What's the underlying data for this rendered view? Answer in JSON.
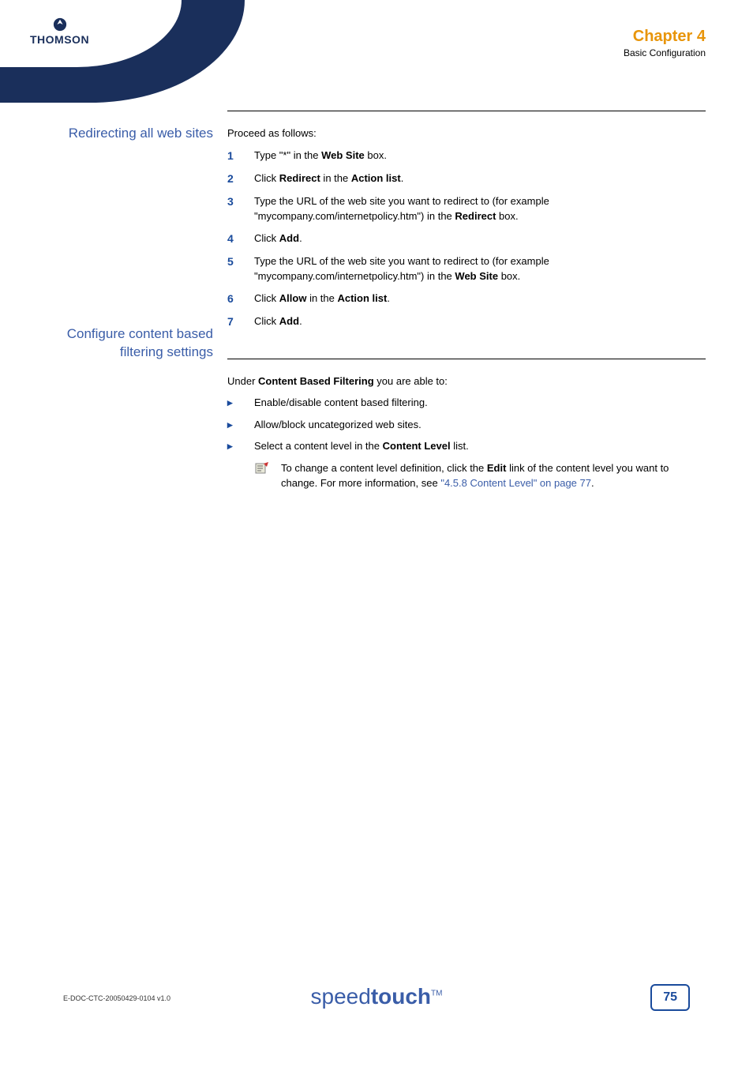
{
  "header": {
    "brand": "THOMSON",
    "chapter": "Chapter 4",
    "subtitle": "Basic Configuration"
  },
  "section1": {
    "label": "Redirecting all web sites",
    "intro": "Proceed as follows:",
    "steps": [
      {
        "n": "1",
        "parts": [
          "Type \"*\" in the ",
          "Web Site",
          " box."
        ]
      },
      {
        "n": "2",
        "parts": [
          "Click ",
          "Redirect",
          " in the ",
          "Action list",
          "."
        ]
      },
      {
        "n": "3",
        "parts": [
          "Type the URL of the web site you want to redirect to (for example \"mycompany.com/internetpolicy.htm\") in the ",
          "Redirect",
          " box."
        ]
      },
      {
        "n": "4",
        "parts": [
          "Click ",
          "Add",
          "."
        ]
      },
      {
        "n": "5",
        "parts": [
          "Type the URL of the web site you want to redirect to (for example \"mycompany.com/internetpolicy.htm\") in the ",
          "Web Site",
          " box."
        ]
      },
      {
        "n": "6",
        "parts": [
          "Click ",
          "Allow",
          " in the ",
          "Action list",
          "."
        ]
      },
      {
        "n": "7",
        "parts": [
          "Click ",
          "Add",
          "."
        ]
      }
    ]
  },
  "section2": {
    "label": "Configure content based filtering settings",
    "intro_parts": [
      "Under ",
      "Content Based Filtering",
      " you are able to:"
    ],
    "bullets": [
      "Enable/disable content based filtering.",
      "Allow/block uncategorized web sites."
    ],
    "bullet3_parts": [
      "Select a content level in the ",
      "Content Level",
      " list."
    ],
    "note_parts": [
      "To change a content level definition, click the ",
      "Edit",
      " link of the content level you want to change. For more information, see "
    ],
    "note_link": "\"4.5.8 Content Level\" on page 77",
    "note_tail": "."
  },
  "footer": {
    "doc": "E-DOC-CTC-20050429-0104 v1.0",
    "logo_light": "speed",
    "logo_bold": "touch",
    "logo_tm": "TM",
    "page": "75"
  }
}
